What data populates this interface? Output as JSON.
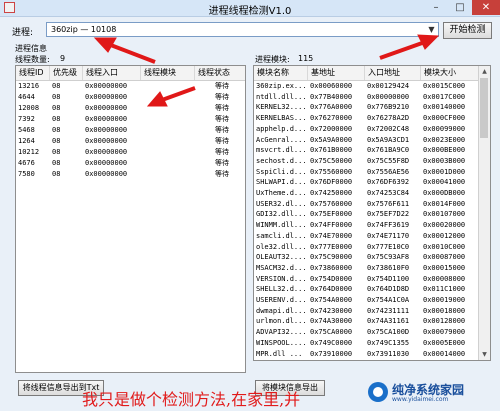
{
  "window": {
    "title": "进程线程检测V1.0"
  },
  "process": {
    "label": "进程:",
    "selected": "360zip — 10108"
  },
  "start_button": "开始检测",
  "thread_group": {
    "title": "进程信息",
    "count_label": "线程数量:",
    "count": "9"
  },
  "thread_table": {
    "columns": [
      "线程ID",
      "优先级",
      "线程入口",
      "线程模块",
      "线程状态"
    ],
    "rows": [
      [
        "13216",
        "08",
        "0x00000000",
        "",
        "等待"
      ],
      [
        "4644",
        "08",
        "0x00000000",
        "",
        "等待"
      ],
      [
        "12008",
        "08",
        "0x00000000",
        "",
        "等待"
      ],
      [
        "7392",
        "08",
        "0x00000000",
        "",
        "等待"
      ],
      [
        "5468",
        "08",
        "0x00000000",
        "",
        "等待"
      ],
      [
        "1264",
        "08",
        "0x00000000",
        "",
        "等待"
      ],
      [
        "10212",
        "08",
        "0x00000000",
        "",
        "等待"
      ],
      [
        "4676",
        "08",
        "0x00000000",
        "",
        "等待"
      ],
      [
        "7580",
        "08",
        "0x00000000",
        "",
        "等待"
      ]
    ]
  },
  "module_group": {
    "count_label": "进程模块:",
    "count": "115"
  },
  "module_table": {
    "columns": [
      "模块名称",
      "基地址",
      "入口地址",
      "模块大小"
    ],
    "rows": [
      [
        "360zip.ex...",
        "0x00060000",
        "0x00129424",
        "0x0015C000"
      ],
      [
        "ntdll.dll...",
        "0x77B40000",
        "0x00000000",
        "0x0017C000"
      ],
      [
        "KERNEL32....",
        "0x776A0000",
        "0x776B9210",
        "0x00140000"
      ],
      [
        "KERNELBAS...",
        "0x76270000",
        "0x76278A2D",
        "0x000CF000"
      ],
      [
        "apphelp.d...",
        "0x72000000",
        "0x72002C48",
        "0x00099000"
      ],
      [
        "AcGenral....",
        "0x5A9A0000",
        "0x5A9A3CD1",
        "0x0023E000"
      ],
      [
        "msvcrt.dl...",
        "0x761B0000",
        "0x761BA9C0",
        "0x000BE000"
      ],
      [
        "sechost.d...",
        "0x75C50000",
        "0x75C55F8D",
        "0x0003B000"
      ],
      [
        "SspiCli.d...",
        "0x75560000",
        "0x7556AE56",
        "0x0001D000"
      ],
      [
        "SHLWAPI.d...",
        "0x76DF0000",
        "0x76DF6392",
        "0x00041000"
      ],
      [
        "UxTheme.d...",
        "0x74250000",
        "0x74253C84",
        "0x000DB000"
      ],
      [
        "USER32.dl...",
        "0x75760000",
        "0x7576F611",
        "0x0014F000"
      ],
      [
        "GDI32.dll...",
        "0x75EF0000",
        "0x75EF7D22",
        "0x00107000"
      ],
      [
        "WINMM.dll...",
        "0x74FF0000",
        "0x74FF3619",
        "0x00020000"
      ],
      [
        "samcli.dl...",
        "0x74E70000",
        "0x74E71170",
        "0x00012000"
      ],
      [
        "ole32.dll...",
        "0x777E0000",
        "0x777E10C0",
        "0x0010C000"
      ],
      [
        "OLEAUT32....",
        "0x75C90000",
        "0x75C93AF8",
        "0x00087000"
      ],
      [
        "MSACM32.d...",
        "0x73860000",
        "0x738610F0",
        "0x00015000"
      ],
      [
        "VERSION.d...",
        "0x754D0000",
        "0x754D1100",
        "0x00008000"
      ],
      [
        "SHELL32.d...",
        "0x764D0000",
        "0x764D1D8D",
        "0x011C1000"
      ],
      [
        "USERENV.d...",
        "0x754A0000",
        "0x754A1C0A",
        "0x00019000"
      ],
      [
        "dwmapi.dl...",
        "0x74230000",
        "0x74231111",
        "0x00018000"
      ],
      [
        "urlmon.dl...",
        "0x74A30000",
        "0x74A31161",
        "0x00128000"
      ],
      [
        "ADVAPI32....",
        "0x75CA0000",
        "0x75CA100D",
        "0x00079000"
      ],
      [
        "WINSPOOL....",
        "0x749C0000",
        "0x749C1355",
        "0x0005E000"
      ],
      [
        "MPR.dll ...",
        "0x73910000",
        "0x73911030",
        "0x00014000"
      ]
    ]
  },
  "buttons": {
    "export_thread": "将线程信息导出到Txt",
    "export_module": "将模块信息导出"
  },
  "caption": "我只是做个检测方法,在家里,并",
  "watermark": {
    "title": "纯净系统家园",
    "url": "www.yidaimei.com"
  }
}
